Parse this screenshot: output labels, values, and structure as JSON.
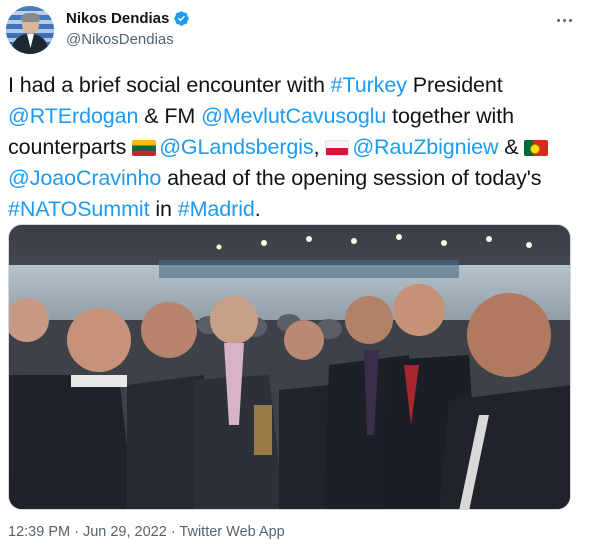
{
  "author": {
    "display_name": "Nikos Dendias",
    "handle": "@NikosDendias",
    "verified": true,
    "avatar_icon": "profile-photo"
  },
  "tweet": {
    "t1": "I had a brief social encounter with ",
    "m_turkey": "#Turkey",
    "t2": " President ",
    "m_erdogan": "@RTErdogan",
    "t3": " & FM ",
    "m_cavusoglu": "@MevlutCavusoglu",
    "t4": " together with counterparts ",
    "m_landsbergis": "@GLandsbergis",
    "t5": ", ",
    "m_rau": "@RauZbigniew",
    "t6": " & ",
    "m_cravinho": "@JoaoCravinho",
    "t7": " ahead of the opening session of today's ",
    "m_nato": "#NATOSummit",
    "t8": " in ",
    "m_madrid": "#Madrid",
    "t9": "."
  },
  "meta": {
    "timestamp": "12:39 PM · Jun 29, 2022 · Twitter Web App"
  },
  "colors": {
    "link": "#1d9bf0",
    "text": "#0f1419",
    "secondary": "#536471"
  }
}
